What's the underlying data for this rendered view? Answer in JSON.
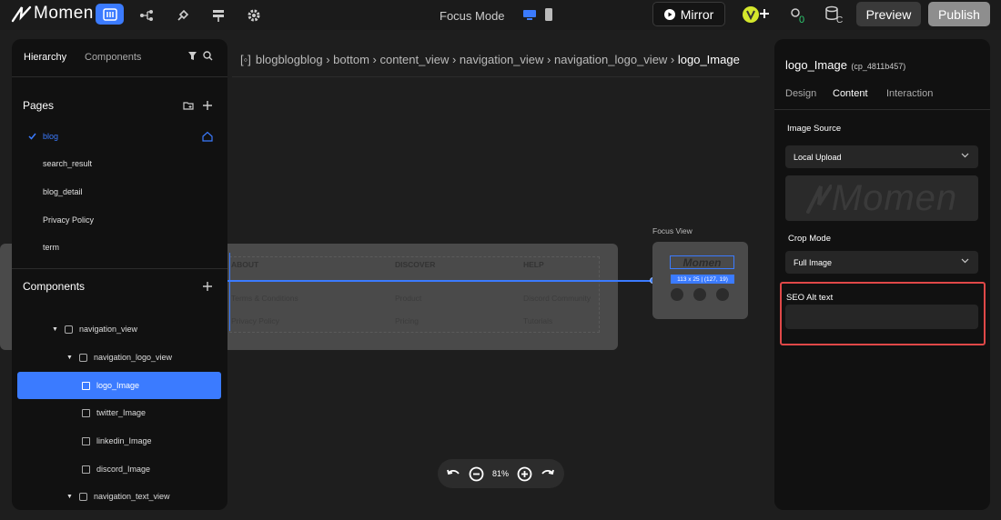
{
  "topbar": {
    "logo_text": "Momen",
    "mode_label": "Focus Mode",
    "mirror_label": "Mirror",
    "preview_label": "Preview",
    "publish_label": "Publish"
  },
  "left_panel": {
    "tabs": [
      "Hierarchy",
      "Components"
    ],
    "pages_title": "Pages",
    "pages": [
      "blog",
      "search_result",
      "blog_detail",
      "Privacy Policy",
      "term"
    ],
    "components_title": "Components",
    "tree": [
      {
        "label": "navigation_view"
      },
      {
        "label": "navigation_logo_view"
      },
      {
        "label": "logo_Image"
      },
      {
        "label": "twitter_Image"
      },
      {
        "label": "linkedin_Image"
      },
      {
        "label": "discord_Image"
      },
      {
        "label": "navigation_text_view"
      }
    ]
  },
  "breadcrumb": {
    "items": [
      "blogblogblog",
      "bottom",
      "content_view",
      "navigation_view",
      "navigation_logo_view"
    ],
    "current": "logo_Image"
  },
  "canvas": {
    "footer_headers": [
      "ABOUT",
      "DISCOVER",
      "HELP"
    ],
    "footer_links": [
      "Terms & Conditions",
      "Product",
      "Discord Community",
      "Privacy Policy",
      "Pricing",
      "Tutorials"
    ],
    "focus_view_label": "Focus View",
    "size_badge": "113 x 25 | (127, 19)",
    "logo_text": "Momen",
    "zoom": "81%"
  },
  "right_panel": {
    "component_name": "logo_Image",
    "component_id": "(cp_4811b457)",
    "tabs": [
      "Design",
      "Content",
      "Interaction"
    ],
    "image_source_label": "Image Source",
    "image_source_value": "Local Upload",
    "preview_text": "Momen",
    "crop_mode_label": "Crop Mode",
    "crop_mode_value": "Full Image",
    "seo_label": "SEO Alt text",
    "seo_value": ""
  },
  "colors": {
    "accent": "#3b7bff",
    "highlight_border": "#e04848"
  }
}
